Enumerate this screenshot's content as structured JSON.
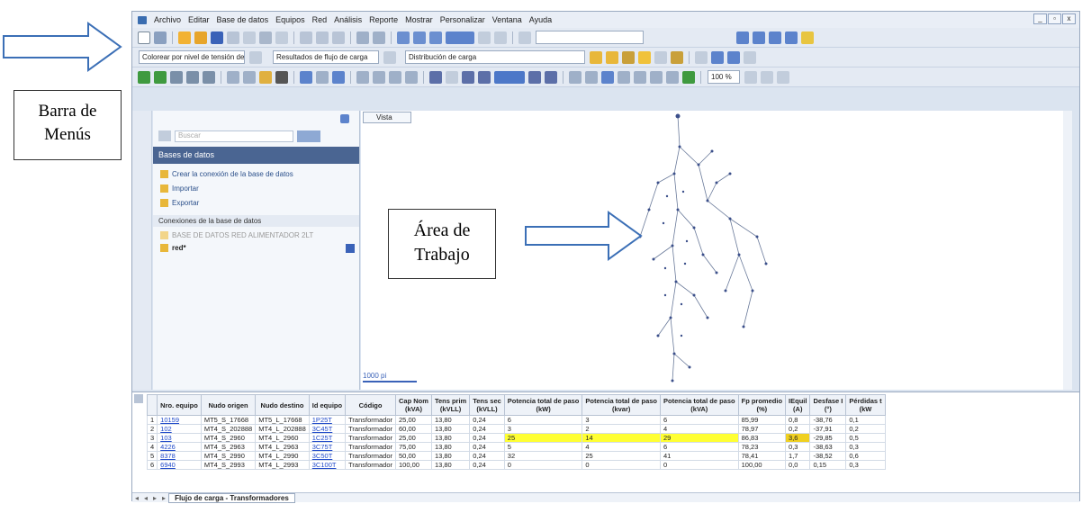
{
  "menu": [
    "Archivo",
    "Editar",
    "Base de datos",
    "Equipos",
    "Red",
    "Análisis",
    "Reporte",
    "Mostrar",
    "Personalizar",
    "Ventana",
    "Ayuda"
  ],
  "window_buttons": [
    "_",
    "▫",
    "x"
  ],
  "toolbar2": {
    "dropdown1": "Colorear por nivel de tensión de base",
    "dropdown2": "Resultados de flujo de carga",
    "dropdown3": "Distribución de carga",
    "zoom": "100 %"
  },
  "panel": {
    "search_placeholder": "Buscar",
    "header": "Bases de datos",
    "create": "Crear la conexión de la base de datos",
    "import": "Importar",
    "export": "Exportar",
    "connections": "Conexiones de la base de datos",
    "db_item": "BASE DE DATOS RED ALIMENTADOR 2LT",
    "net_item": "red*"
  },
  "work": {
    "tab": "Vista",
    "scale": "1000 pi"
  },
  "grid": {
    "columns": [
      {
        "name": "",
        "unit": ""
      },
      {
        "name": "Nro. equipo",
        "unit": ""
      },
      {
        "name": "Nudo origen",
        "unit": ""
      },
      {
        "name": "Nudo destino",
        "unit": ""
      },
      {
        "name": "Id equipo",
        "unit": ""
      },
      {
        "name": "Código",
        "unit": ""
      },
      {
        "name": "Cap Nom",
        "unit": "(kVA)"
      },
      {
        "name": "Tens prim",
        "unit": "(kVLL)"
      },
      {
        "name": "Tens sec",
        "unit": "(kVLL)"
      },
      {
        "name": "Potencia total de paso",
        "unit": "(kW)"
      },
      {
        "name": "Potencia total de paso",
        "unit": "(kvar)"
      },
      {
        "name": "Potencia total de paso",
        "unit": "(kVA)"
      },
      {
        "name": "Fp promedio",
        "unit": "(%)"
      },
      {
        "name": "IEquil",
        "unit": "(A)"
      },
      {
        "name": "Desfase I",
        "unit": "(°)"
      },
      {
        "name": "Pérdidas t",
        "unit": "(kW"
      }
    ],
    "rows": [
      [
        "1",
        "10159",
        "MT5_S_17668",
        "MT5_L_17668",
        "1P25T",
        "Transformador",
        "25,00",
        "13,80",
        "0,24",
        "6",
        "3",
        "6",
        "85,99",
        "0,8",
        "-38,76",
        "0,1"
      ],
      [
        "2",
        "102",
        "MT4_S_202888",
        "MT4_L_202888",
        "3C45T",
        "Transformador",
        "60,00",
        "13,80",
        "0,24",
        "3",
        "2",
        "4",
        "78,97",
        "0,2",
        "-37,91",
        "0,2"
      ],
      [
        "3",
        "103",
        "MT4_S_2960",
        "MT4_L_2960",
        "1C25T",
        "Transformador",
        "25,00",
        "13,80",
        "0,24",
        "25",
        "14",
        "29",
        "86,83",
        "3,6",
        "-29,85",
        "0,5"
      ],
      [
        "4",
        "4226",
        "MT4_S_2963",
        "MT4_L_2963",
        "3C75T",
        "Transformador",
        "75,00",
        "13,80",
        "0,24",
        "5",
        "4",
        "6",
        "78,23",
        "0,3",
        "-38,63",
        "0,3"
      ],
      [
        "5",
        "8378",
        "MT4_S_2990",
        "MT4_L_2990",
        "3C50T",
        "Transformador",
        "50,00",
        "13,80",
        "0,24",
        "32",
        "25",
        "41",
        "78,41",
        "1,7",
        "-38,52",
        "0,6"
      ],
      [
        "6",
        "6940",
        "MT4_S_2993",
        "MT4_L_2993",
        "3C100T",
        "Transformador",
        "100,00",
        "13,80",
        "0,24",
        "0",
        "0",
        "0",
        "100,00",
        "0,0",
        "0,15",
        "0,3"
      ]
    ],
    "sheet_tab": "Flujo de carga - Transformadores"
  },
  "annotations": {
    "menu_label": "Barra de Menús",
    "work_label": "Área de Trabajo"
  },
  "colors": {
    "highlight": "#ffff33",
    "panel_header": "#4a6592",
    "link": "#1f49c9"
  }
}
